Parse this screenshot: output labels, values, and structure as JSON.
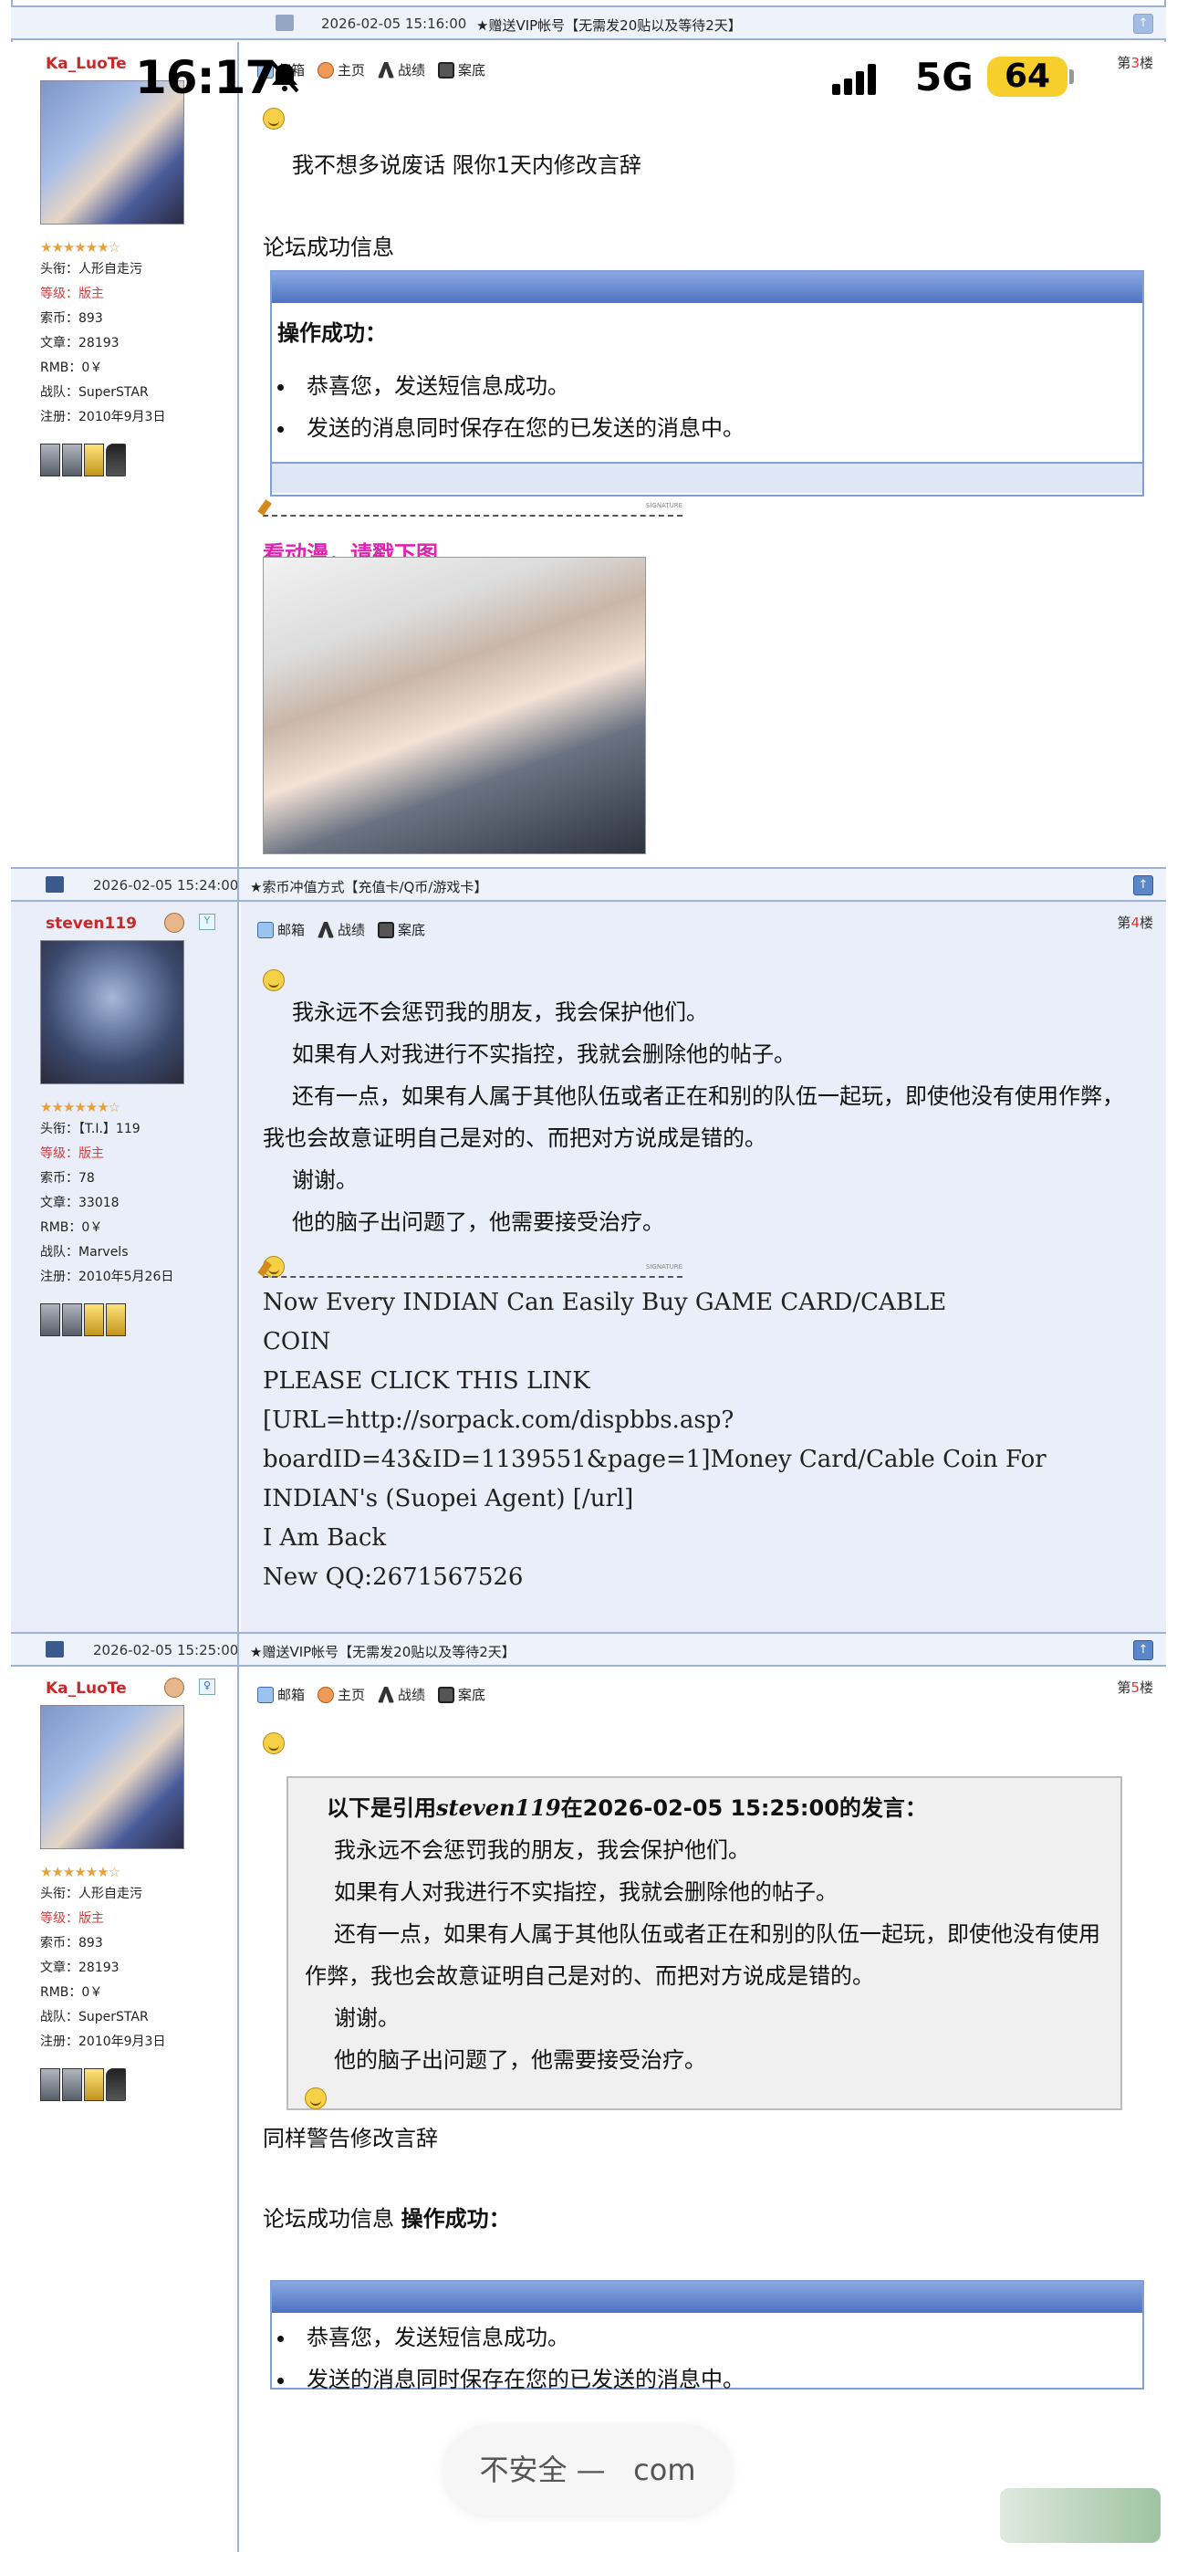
{
  "status_bar": {
    "time": "16:17",
    "network": "5G",
    "battery": "64"
  },
  "top_bar": {
    "date": "2026-02-05 15:16:00",
    "ad": "★赠送VIP帐号【无需发20贴以及等待2天】"
  },
  "post1": {
    "username": "Ka_LuoTe",
    "floor_prefix": "第",
    "floor_num": "3",
    "floor_suffix": "楼",
    "stars": "★★★★★★☆",
    "info": {
      "title": "头衔：人形自走污",
      "level": "等级：版主",
      "coins": "索币：893",
      "articles": "文章：28193",
      "rmb": "RMB：0￥",
      "team": "战队：SuperSTAR",
      "joined": "注册：2010年9月3日"
    },
    "actions": {
      "mail": "邮箱",
      "home": "主页",
      "battle": "战绩",
      "record": "案底"
    },
    "lines": [
      "我不想多说废话 限你1天内修改言辞",
      "论坛成功信息",
      "操作成功：",
      "恭喜您，发送短信息成功。",
      "发送的消息同时保存在您的已发送的消息中。"
    ],
    "sig_label": "SIGNATURE",
    "pink": "看动漫，请戳下图"
  },
  "bar2": {
    "date": "2026-02-05 15:24:00",
    "ad": "★索币冲值方式【充值卡/Q币/游戏卡】"
  },
  "post2": {
    "username": "steven119",
    "floor_prefix": "第",
    "floor_num": "4",
    "floor_suffix": "楼",
    "stars": "★★★★★★☆",
    "info": {
      "title": "头衔：【T.I.】119",
      "level": "等级：版主",
      "coins": "索币：78",
      "articles": "文章：33018",
      "rmb": "RMB：0￥",
      "team": "战队：Marvels",
      "joined": "注册：2010年5月26日"
    },
    "actions": {
      "mail": "邮箱",
      "battle": "战绩",
      "record": "案底"
    },
    "lines": [
      "我永远不会惩罚我的朋友，我会保护他们。",
      "如果有人对我进行不实指控，我就会删除他的帖子。",
      "还有一点，如果有人属于其他队伍或者正在和别的队伍一起玩，即使他没有使用作弊，我也会故意证明自己是对的、而把对方说成是错的。",
      "谢谢。",
      "他的脑子出问题了，他需要接受治疗。"
    ],
    "sig_label": "SIGNATURE",
    "sig_lines": [
      "Now Every INDIAN Can Easily Buy GAME CARD/CABLE",
      "COIN",
      "PLEASE CLICK THIS LINK",
      "[URL=http://sorpack.com/dispbbs.asp?",
      "boardID=43&ID=1139551&page=1]Money Card/Cable Coin For",
      "INDIAN's (Suopei Agent) [/url]",
      "I Am Back",
      "New QQ:2671567526"
    ]
  },
  "bar3": {
    "date": "2026-02-05 15:25:00",
    "ad": "★赠送VIP帐号【无需发20贴以及等待2天】"
  },
  "post3": {
    "username": "Ka_LuoTe",
    "floor_prefix": "第",
    "floor_num": "5",
    "floor_suffix": "楼",
    "stars": "★★★★★★☆",
    "info": {
      "title": "头衔：人形自走污",
      "level": "等级：版主",
      "coins": "索币：893",
      "articles": "文章：28193",
      "rmb": "RMB：0￥",
      "team": "战队：SuperSTAR",
      "joined": "注册：2010年9月3日"
    },
    "actions": {
      "mail": "邮箱",
      "home": "主页",
      "battle": "战绩",
      "record": "案底"
    },
    "quote_head_a": "以下是引用",
    "quote_head_user": "steven119",
    "quote_head_b": "在2026-02-05 15:25:00的发言：",
    "quote_lines": [
      "我永远不会惩罚我的朋友，我会保护他们。",
      "如果有人对我进行不实指控，我就会删除他的帖子。",
      "还有一点，如果有人属于其他队伍或者正在和别的队伍一起玩，即使他没有使用作弊，我也会故意证明自己是对的、而把对方说成是错的。",
      "谢谢。",
      "他的脑子出问题了，他需要接受治疗。"
    ],
    "lines": [
      "同样警告修改言辞",
      "论坛成功信息",
      "操作成功：",
      "恭喜您，发送短信息成功。",
      "发送的消息同时保存在您的已发送的消息中。"
    ]
  },
  "url_bar": {
    "insecure": "不安全 —",
    "domain": "com"
  }
}
